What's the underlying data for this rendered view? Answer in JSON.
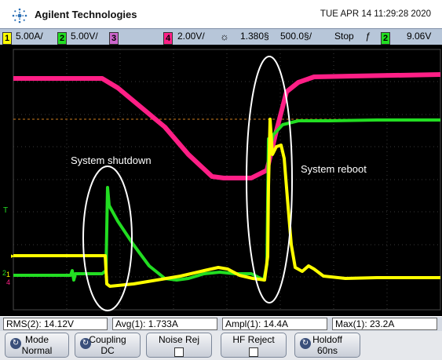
{
  "header": {
    "brand": "Agilent Technologies",
    "timestamp": "TUE APR 14 11:29:28 2020"
  },
  "status": {
    "ch1_num": "1",
    "ch1_scale": "5.00A/",
    "ch2_num": "2",
    "ch2_scale": "5.00V/",
    "ch3_num": "3",
    "ch4_num": "4",
    "ch4_scale": "2.00V/",
    "trig_delay": "1.380§",
    "timebase": "500.0§/",
    "run_state": "Stop",
    "trig_edge": "ƒ",
    "trig_src": "2",
    "trig_level": "9.06V"
  },
  "colors": {
    "ch1": "#ffff00",
    "ch2": "#22dd22",
    "ch3": "#cc66cc",
    "ch4": "#ff1f86",
    "ellipse": "#ffffff"
  },
  "annotations": {
    "shutdown": "System shutdown",
    "reboot": "System reboot"
  },
  "markers": {
    "trig": "T",
    "ch1": "1",
    "ch2": "2",
    "ch4": "4"
  },
  "measurements": {
    "rms": "RMS(2): 14.12V",
    "avg": "Avg(1): 1.733A",
    "ampl": "Ampl(1): 14.4A",
    "max": "Max(1): 23.2A"
  },
  "softkeys": {
    "mode_title": "Mode",
    "mode_value": "Normal",
    "coupling_title": "Coupling",
    "coupling_value": "DC",
    "noise_title": "Noise Rej",
    "hf_title": "HF Reject",
    "holdoff_title": "Holdoff",
    "holdoff_value": "60ns",
    "icon_mode": "rotate-knob-icon",
    "icon_coupling": "rotate-knob-icon",
    "icon_holdoff": "rotate-knob-icon"
  }
}
